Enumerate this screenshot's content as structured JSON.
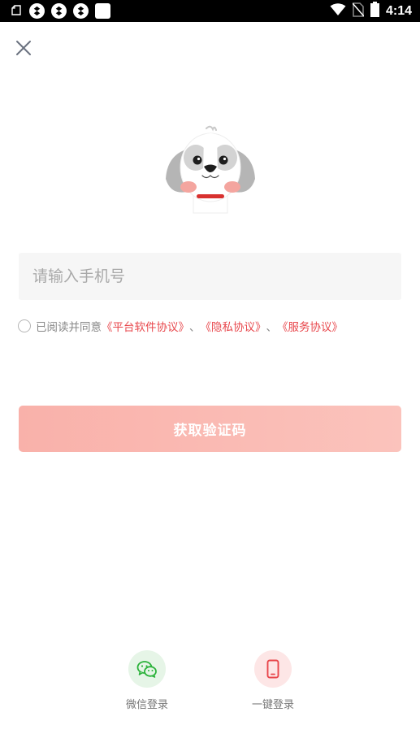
{
  "status_bar": {
    "time": "4:14",
    "icons": [
      "notification-icon",
      "app-icon",
      "app-icon",
      "app-icon",
      "square-icon",
      "wifi-icon",
      "no-sim-icon",
      "battery-icon"
    ]
  },
  "header": {
    "close_icon": "close-icon"
  },
  "login": {
    "phone_placeholder": "请输入手机号",
    "agreement": {
      "prefix": "已阅读并同意",
      "platform_link": "《平台软件协议》",
      "separator1": "、",
      "privacy_link": "《隐私协议》",
      "separator2": "、",
      "service_link": "《服务协议》"
    },
    "get_code_label": "获取验证码"
  },
  "alt_login": {
    "wechat_label": "微信登录",
    "onekey_label": "一键登录"
  },
  "colors": {
    "accent": "#e8474c",
    "button_start": "#f9b1aa",
    "button_end": "#fbc3bc",
    "wechat_green": "#2bb23a"
  }
}
